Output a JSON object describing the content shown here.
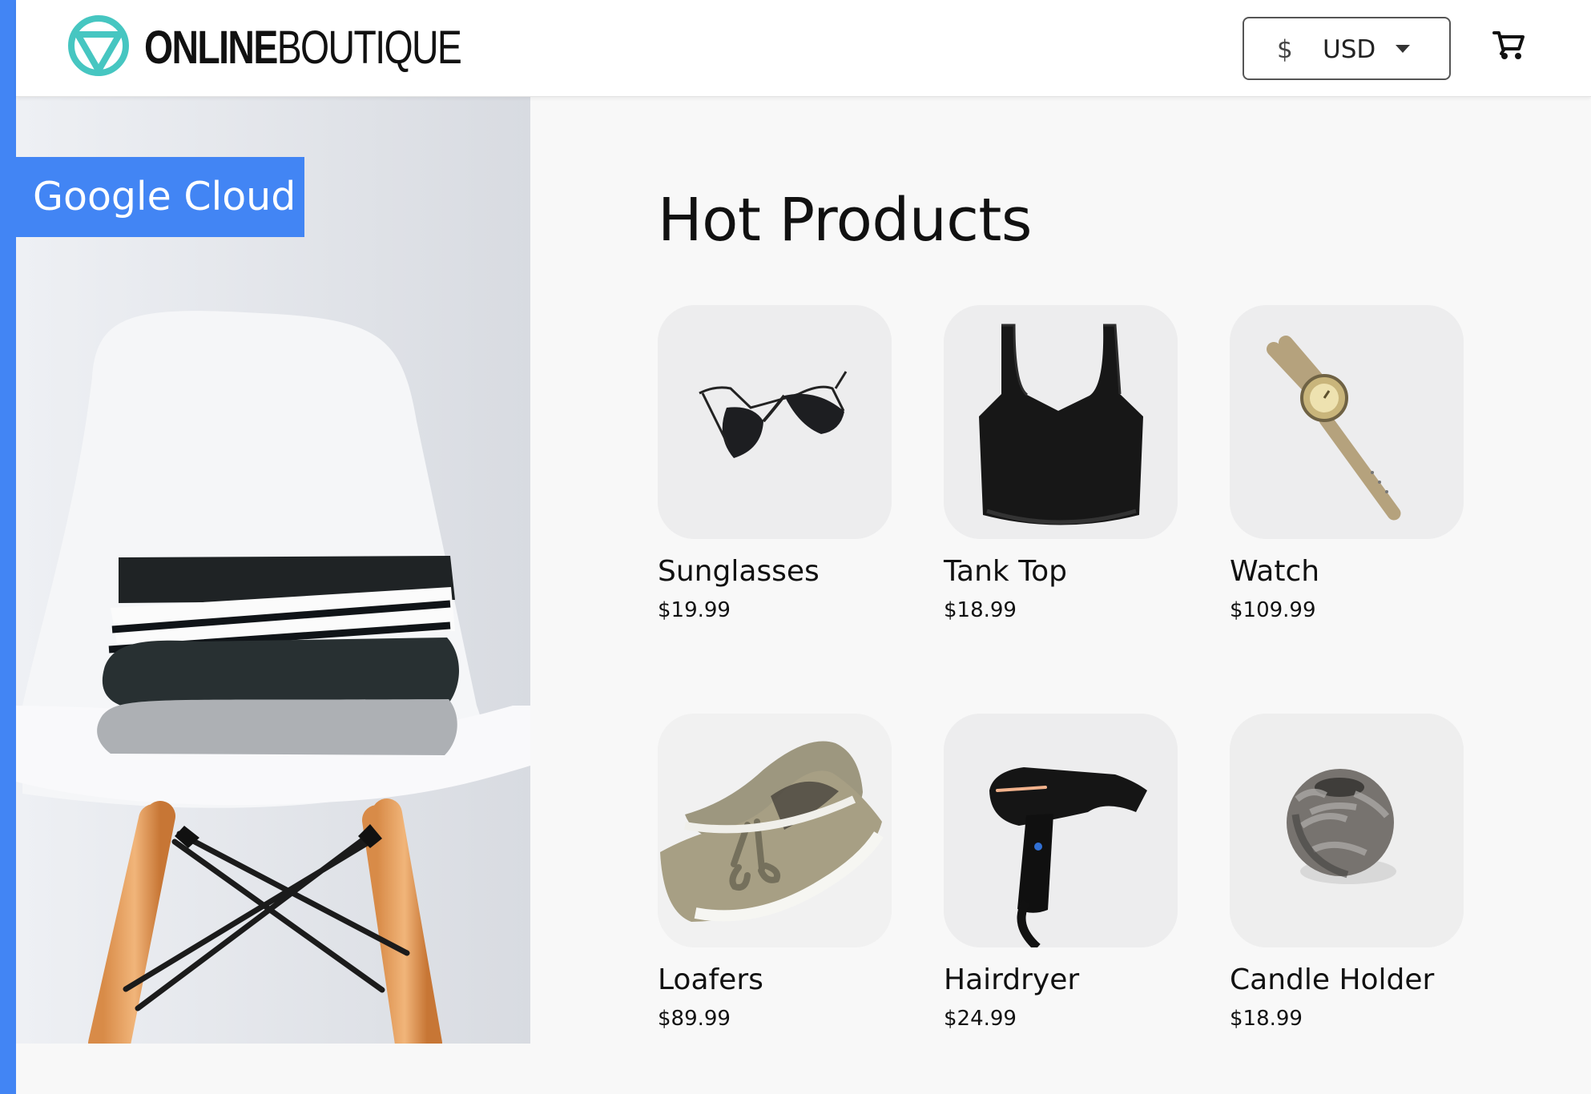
{
  "app": {
    "brand": {
      "online": "ONLINE",
      "boutique": "BOUTIQUE"
    },
    "header": {
      "currency_symbol": "$",
      "currency_code": "USD",
      "cart_icon": "cart-icon"
    },
    "hero": {
      "badge": "Google Cloud"
    },
    "main": {
      "title": "Hot Products",
      "products": [
        {
          "name": "Sunglasses",
          "price": "$19.99",
          "icon": "sunglasses-image"
        },
        {
          "name": "Tank Top",
          "price": "$18.99",
          "icon": "tank-top-image"
        },
        {
          "name": "Watch",
          "price": "$109.99",
          "icon": "watch-image"
        },
        {
          "name": "Loafers",
          "price": "$89.99",
          "icon": "loafers-image"
        },
        {
          "name": "Hairdryer",
          "price": "$24.99",
          "icon": "hairdryer-image"
        },
        {
          "name": "Candle Holder",
          "price": "$18.99",
          "icon": "candle-holder-image"
        }
      ]
    },
    "colors": {
      "accent": "#4285f4",
      "logo_teal": "#46c6c1"
    }
  }
}
